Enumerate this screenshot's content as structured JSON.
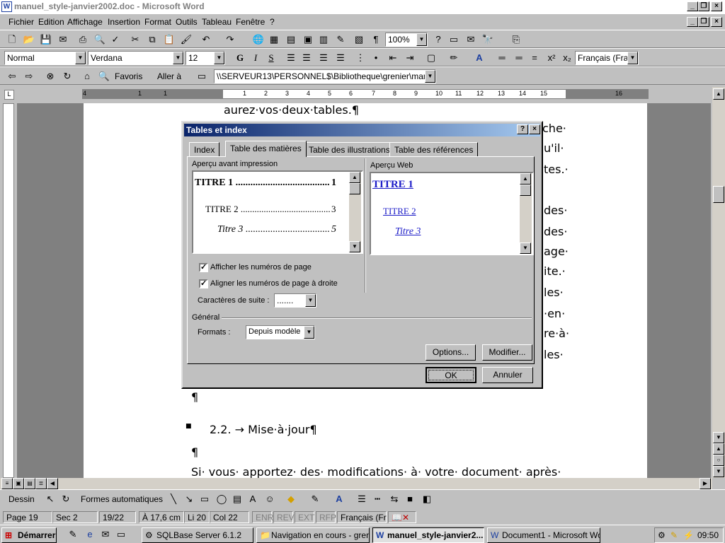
{
  "window": {
    "title": "manuel_style-janvier2002.doc - Microsoft Word"
  },
  "menu": [
    "Fichier",
    "Edition",
    "Affichage",
    "Insertion",
    "Format",
    "Outils",
    "Tableau",
    "Fenêtre",
    "?"
  ],
  "toolbar": {
    "zoom": "100%"
  },
  "formatting": {
    "style": "Normal",
    "font": "Verdana",
    "size": "12",
    "language": "Français (Franc"
  },
  "web": {
    "favoris": "Favoris",
    "aller": "Aller à",
    "address": "\\\\SERVEUR13\\PERSONNEL$\\Bibliotheque\\grenier\\manuel_styl"
  },
  "ruler": {
    "labels": [
      "4",
      "1",
      "2",
      "1",
      "1",
      "2",
      "3",
      "4",
      "5",
      "6",
      "7",
      "8",
      "9",
      "10",
      "11",
      "12",
      "13",
      "14",
      "15",
      "16"
    ]
  },
  "document": {
    "line1": "aurez·vos·deux·tables.¶",
    "right_frag": [
      "che·",
      "u'il·",
      "tes.·",
      "des·",
      "des·",
      "age·",
      "ite.·",
      "les·",
      "·en·",
      "re·à·",
      "les·"
    ],
    "para": "¶",
    "heading": "2.2.  →  Mise·à·jour¶",
    "para2": "¶",
    "last": "Si· vous· apportez· des· modifications· à· votre· document· après·"
  },
  "dialog": {
    "title": "Tables et index",
    "tabs": [
      "Index",
      "Table des matières",
      "Table des illustrations",
      "Table des références"
    ],
    "print_preview_label": "Aperçu avant impression",
    "web_preview_label": "Aperçu Web",
    "print_entries": [
      {
        "text": "TITRE 1",
        "page": "1"
      },
      {
        "text": "TITRE 2",
        "page": "3"
      },
      {
        "text": "Titre 3",
        "page": "5"
      }
    ],
    "web_entries": [
      "TITRE 1",
      "TITRE 2",
      "Titre 3"
    ],
    "show_page_numbers": "Afficher les numéros de page",
    "align_right": "Aligner les numéros de page à droite",
    "leader_label": "Caractères de suite :",
    "leader_value": ".......",
    "general_label": "Général",
    "formats_label": "Formats :",
    "formats_value": "Depuis modèle",
    "options_button": "Options...",
    "modify_button": "Modifier...",
    "ok_button": "OK",
    "cancel_button": "Annuler"
  },
  "drawbar": {
    "dessin": "Dessin",
    "formes": "Formes automatiques"
  },
  "status": {
    "page": "Page 19",
    "sec": "Sec 2",
    "pages": "19/22",
    "pos": "À 17,6 cm",
    "line": "Li 20",
    "col": "Col 22",
    "enr": "ENR",
    "rev": "REV",
    "ext": "EXT",
    "rfp": "RFP",
    "lang": "Français (Fr"
  },
  "taskbar": {
    "start": "Démarrer",
    "items": [
      "SQLBase Server 6.1.2",
      "Navigation en cours - grenier",
      "manuel_style-janvier2...",
      "Document1 - Microsoft Word"
    ],
    "clock": "09:50"
  }
}
